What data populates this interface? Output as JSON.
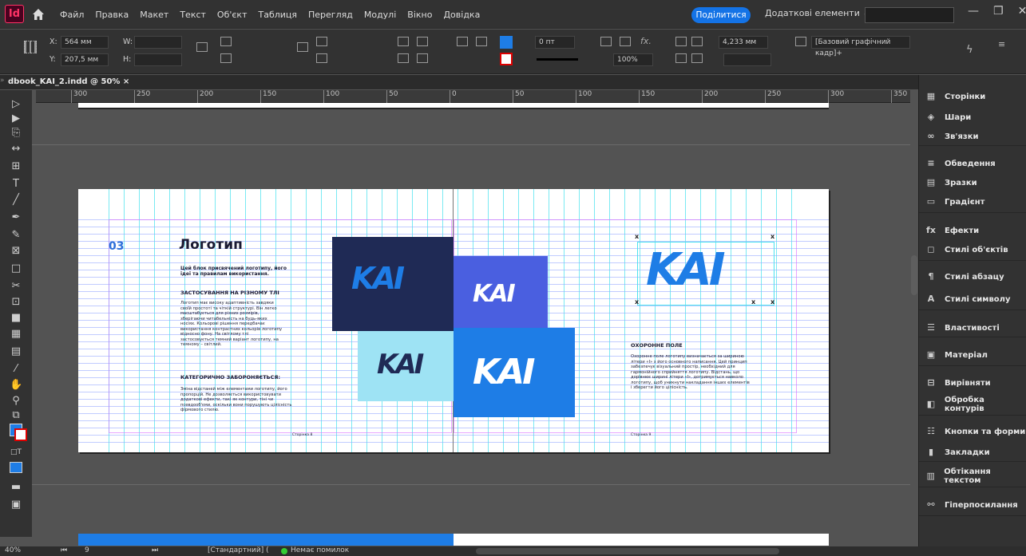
{
  "app": {
    "icon_text": "Id"
  },
  "menu": {
    "items": [
      "Файл",
      "Правка",
      "Макет",
      "Текст",
      "Об'єкт",
      "Таблиця",
      "Перегляд",
      "Модулі",
      "Вікно",
      "Довідка"
    ],
    "share_label": "Поділитися",
    "extras_label": "Додаткові елементи ⌄"
  },
  "control": {
    "x_label": "X:",
    "x_value": "564 мм",
    "y_label": "Y:",
    "y_value": "207,5 мм",
    "w_label": "W:",
    "h_label": "H:",
    "stroke_value": "0 пт",
    "opacity_value": "100%",
    "size_value": "4,233 мм",
    "frame_style": "[Базовий графічний кадр]+"
  },
  "document": {
    "tab_title": "dbook_KAI_2.indd @ 50%",
    "close_glyph": "×"
  },
  "ruler": {
    "ticks": [
      "300",
      "250",
      "200",
      "150",
      "100",
      "50",
      "0",
      "50",
      "100",
      "150",
      "200",
      "250",
      "300",
      "350"
    ]
  },
  "page_left": {
    "number": "03",
    "title": "Логотип",
    "intro": "Цей блок присвячений логотипу, його ідеї та правилам використання.",
    "h1": "ЗАСТОСУВАННЯ НА РІЗНОМУ ТЛІ",
    "p1": "Логотип має високу адаптивність завдяки своїй простоті та чіткій структурі. Він легко масштабується для різних розмірів, зберігаючи читабельність на будь-яких носіях. Кольорові рішення передбачає використання контрастних кольорів логотипу відносно фону. На світлому тлі застосовується темний варіант логотипу, на темному – світлий.",
    "h2": "КАТЕГОРИЧНО ЗАБОРОНЯЄТЬСЯ:",
    "p2": "Зміна відстаней між елементами логотипу, його пропорцій. Не дозволяється використовувати додаткові ефекти, такі як контури, тіні чи псевдооб'єми, оскільки вони порушують цілісність фірмового стилю.",
    "footer": "Сторінка 8",
    "logo_text": "KAI"
  },
  "page_right": {
    "h": "ОХОРОННЕ ПОЛЕ",
    "p": "Охоронне поле логотипу визначається за шириною літери «I» з його основного написання. Цей принцип забезпечує візуальний простір, необхідний для гармонійного сприйняття логотипу. Відстань, що дорівнює ширині літери «I», дотримується навколо логотипу, щоб уникнути накладання інших елементів і зберегти його цілісність.",
    "footer": "Сторінка 9",
    "marker": "x",
    "logo_text": "KAI"
  },
  "colors": {
    "navy": "#1f2a55",
    "royal": "#4a5fe0",
    "sky": "#9ee3f4",
    "blue": "#1e7de6",
    "accent_text": "#2c6fd9"
  },
  "panels": [
    {
      "icon": "pages-icon",
      "glyph": "▦",
      "label": "Сторінки"
    },
    {
      "icon": "layers-icon",
      "glyph": "◈",
      "label": "Шари"
    },
    {
      "icon": "links-icon",
      "glyph": "∞",
      "label": "Зв'язки"
    },
    {
      "icon": "stroke-icon",
      "glyph": "≡",
      "label": "Обведення"
    },
    {
      "icon": "swatches-icon",
      "glyph": "▤",
      "label": "Зразки"
    },
    {
      "icon": "gradient-icon",
      "glyph": "▭",
      "label": "Градієнт"
    },
    {
      "icon": "effects-icon",
      "glyph": "fx",
      "label": "Ефекти"
    },
    {
      "icon": "object-styles-icon",
      "glyph": "◻",
      "label": "Стилі об'єктів"
    },
    {
      "icon": "paragraph-styles-icon",
      "glyph": "¶",
      "label": "Стилі абзацу"
    },
    {
      "icon": "character-styles-icon",
      "glyph": "A",
      "label": "Стилі символу"
    },
    {
      "icon": "properties-icon",
      "glyph": "☰",
      "label": "Властивості"
    },
    {
      "icon": "material-icon",
      "glyph": "▣",
      "label": "Матеріал"
    },
    {
      "icon": "align-icon",
      "glyph": "⊟",
      "label": "Вирівняти"
    },
    {
      "icon": "pathfinder-icon",
      "glyph": "◧",
      "label": "Обробка контурів"
    },
    {
      "icon": "buttons-forms-icon",
      "glyph": "☷",
      "label": "Кнопки та форми"
    },
    {
      "icon": "bookmarks-icon",
      "glyph": "▮",
      "label": "Закладки"
    },
    {
      "icon": "text-wrap-icon",
      "glyph": "▥",
      "label": "Обтікання текстом"
    },
    {
      "icon": "hyperlinks-icon",
      "glyph": "⚯",
      "label": "Гіперпосилання"
    }
  ],
  "status": {
    "zoom": "40%",
    "page": "9",
    "style": "[Стандартний] (",
    "errors": "Немає помилок"
  }
}
